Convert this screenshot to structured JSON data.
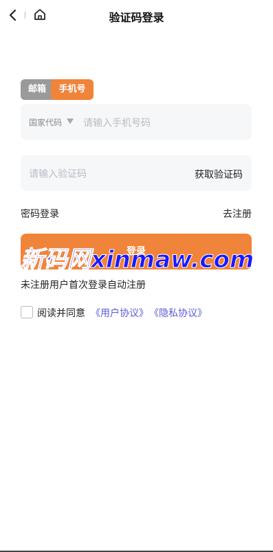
{
  "header": {
    "title": "验证码登录",
    "back_icon": "chevron-left-icon",
    "home_icon": "home-icon"
  },
  "tabs": [
    {
      "label": "邮箱",
      "active": false
    },
    {
      "label": "手机号",
      "active": true
    }
  ],
  "phone_field": {
    "country_label": "国家代码",
    "placeholder": "请输入手机号码"
  },
  "code_field": {
    "placeholder": "请输入验证码",
    "get_code_label": "获取验证码"
  },
  "links": {
    "password_login": "密码登录",
    "register": "去注册"
  },
  "login_button": {
    "label": "登录"
  },
  "watermark": "新码网xinmaw.com",
  "hint": "未注册用户首次登录自动注册",
  "agreement": {
    "checked": false,
    "text": "阅读并同意",
    "user_agreement": "《用户协议》",
    "privacy_policy": "《隐私协议》"
  },
  "colors": {
    "accent": "#f0843a",
    "link": "#5b5bd6",
    "tab_inactive": "#9a9a9a"
  }
}
